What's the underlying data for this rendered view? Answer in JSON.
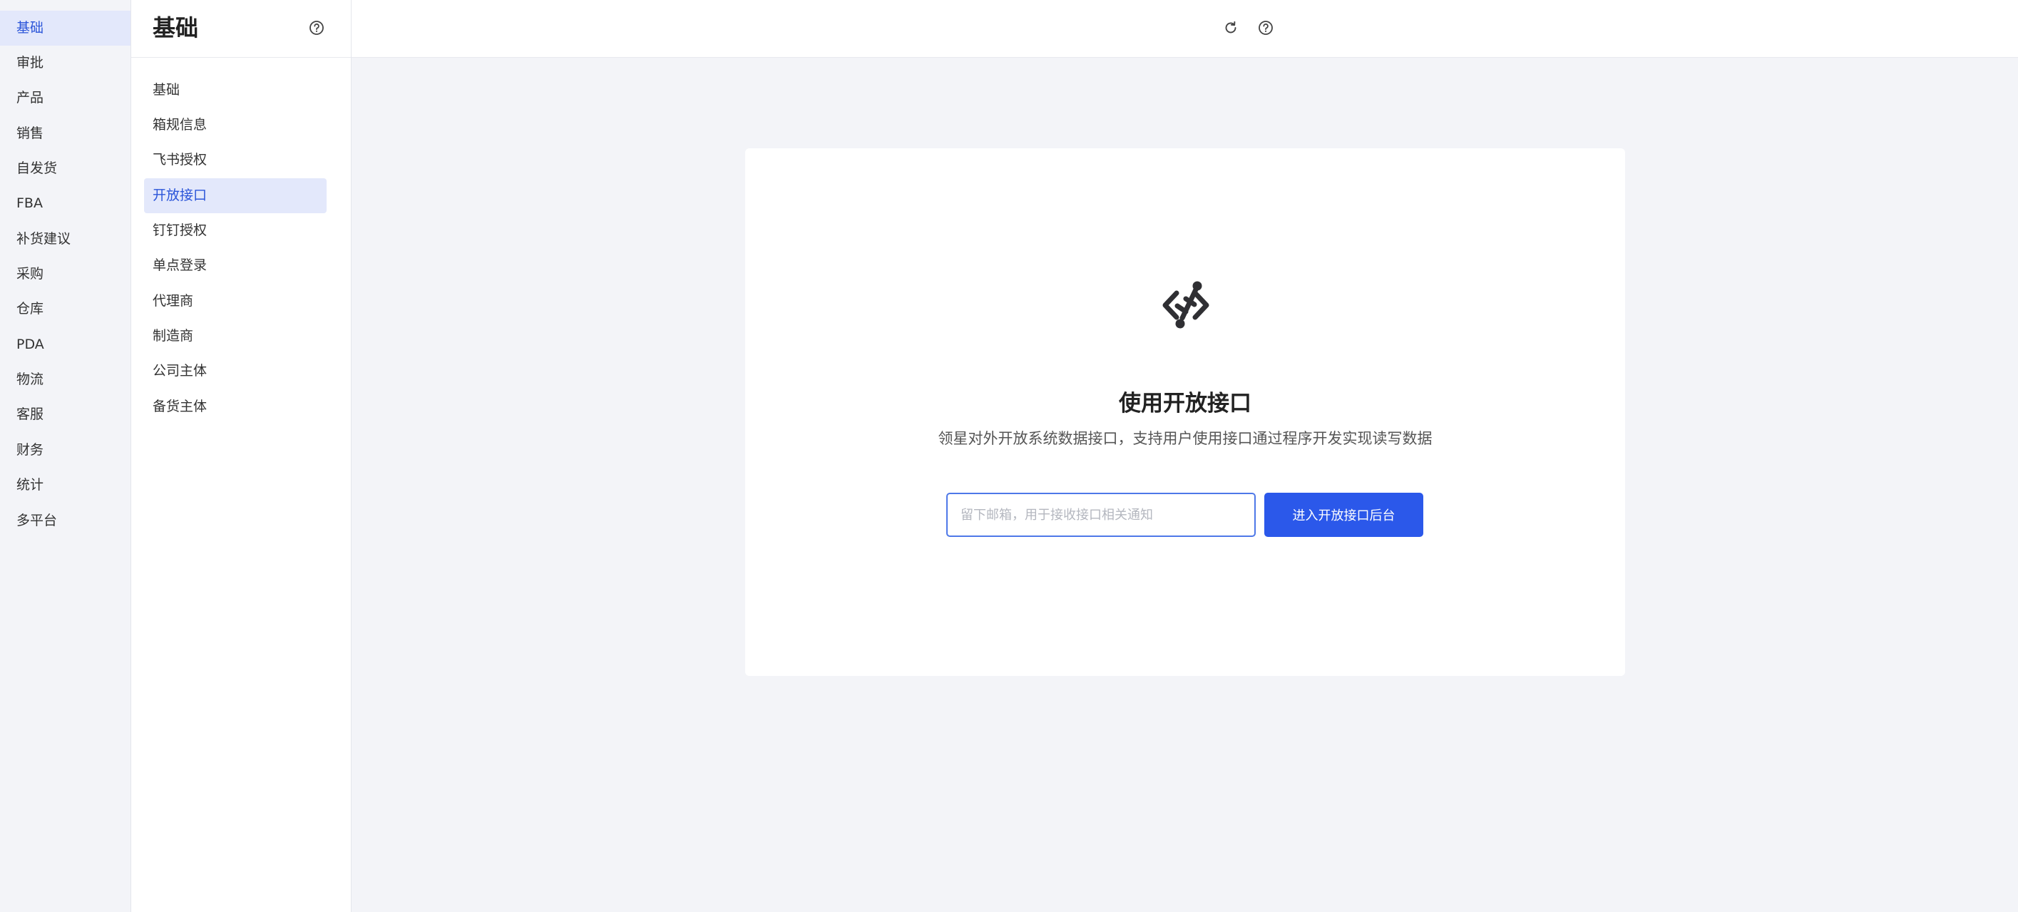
{
  "nav_primary": [
    {
      "label": "基础"
    },
    {
      "label": "审批"
    },
    {
      "label": "产品"
    },
    {
      "label": "销售"
    },
    {
      "label": "自发货"
    },
    {
      "label": "FBA"
    },
    {
      "label": "补货建议"
    },
    {
      "label": "采购"
    },
    {
      "label": "仓库"
    },
    {
      "label": "PDA"
    },
    {
      "label": "物流"
    },
    {
      "label": "客服"
    },
    {
      "label": "财务"
    },
    {
      "label": "统计"
    },
    {
      "label": "多平台"
    }
  ],
  "nav_secondary": {
    "title": "基础",
    "items": [
      {
        "label": "基础"
      },
      {
        "label": "箱规信息"
      },
      {
        "label": "飞书授权"
      },
      {
        "label": "开放接口"
      },
      {
        "label": "钉钉授权"
      },
      {
        "label": "单点登录"
      },
      {
        "label": "代理商"
      },
      {
        "label": "制造商"
      },
      {
        "label": "公司主体"
      },
      {
        "label": "备货主体"
      }
    ]
  },
  "main": {
    "title": "使用开放接口",
    "description": "领星对外开放系统数据接口，支持用户使用接口通过程序开发实现读写数据",
    "email_input": {
      "placeholder": "留下邮箱，用于接收接口相关通知",
      "value": ""
    },
    "enter_button_label": "进入开放接口后台"
  },
  "icons": {
    "help": "help-circle-icon",
    "refresh": "refresh-icon",
    "hero": "api-link-icon"
  },
  "colors": {
    "accent": "#2b58ea",
    "active_bg": "#e3e8fb",
    "active_text": "#2b55d9"
  }
}
